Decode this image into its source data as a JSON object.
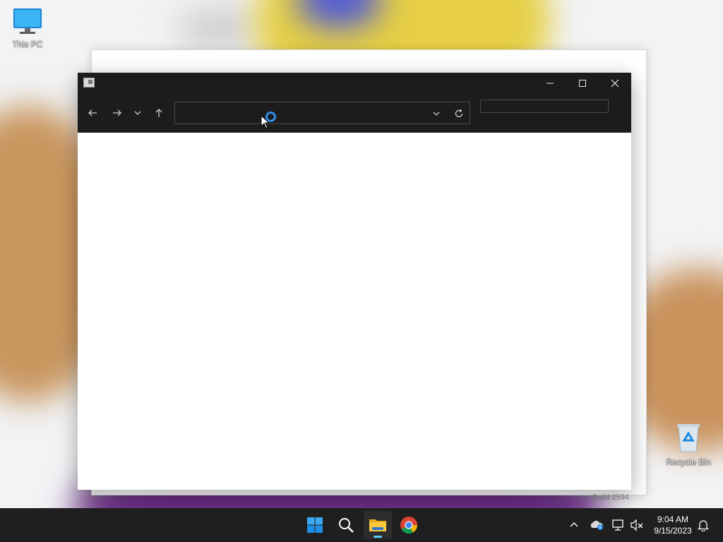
{
  "desktop": {
    "icons": [
      {
        "label": "This PC",
        "icon": "monitor-icon"
      },
      {
        "label": "Recycle Bin",
        "icon": "recycle-bin-icon"
      }
    ],
    "watermark": "Build 2594"
  },
  "window": {
    "title": "",
    "controls": {
      "minimize": "minimize-icon",
      "maximize": "maximize-icon",
      "close": "close-icon"
    },
    "toolbar": {
      "back": "arrow-left-icon",
      "forward": "arrow-right-icon",
      "recent": "chevron-down-icon",
      "up": "arrow-up-icon",
      "address_value": "",
      "address_state": "loading",
      "refresh": "refresh-icon",
      "search_value": ""
    }
  },
  "taskbar": {
    "apps": [
      {
        "name": "start",
        "icon": "windows-logo-icon",
        "active": false
      },
      {
        "name": "search",
        "icon": "search-icon",
        "active": false
      },
      {
        "name": "file-explorer",
        "icon": "folder-icon",
        "active": true
      },
      {
        "name": "chrome",
        "icon": "chrome-icon",
        "active": false
      }
    ],
    "tray": {
      "icons": [
        "chevron-up-icon",
        "onedrive-icon",
        "network-icon",
        "volume-muted-icon",
        "notification-bell-icon"
      ],
      "time": "9:04 AM",
      "date": "9/15/2023"
    }
  },
  "colors": {
    "titlebar_bg": "#1c1c1c",
    "taskbar_bg": "#1f1f1f",
    "accent": "#2d8fe8",
    "indicator": "#60cdff"
  }
}
